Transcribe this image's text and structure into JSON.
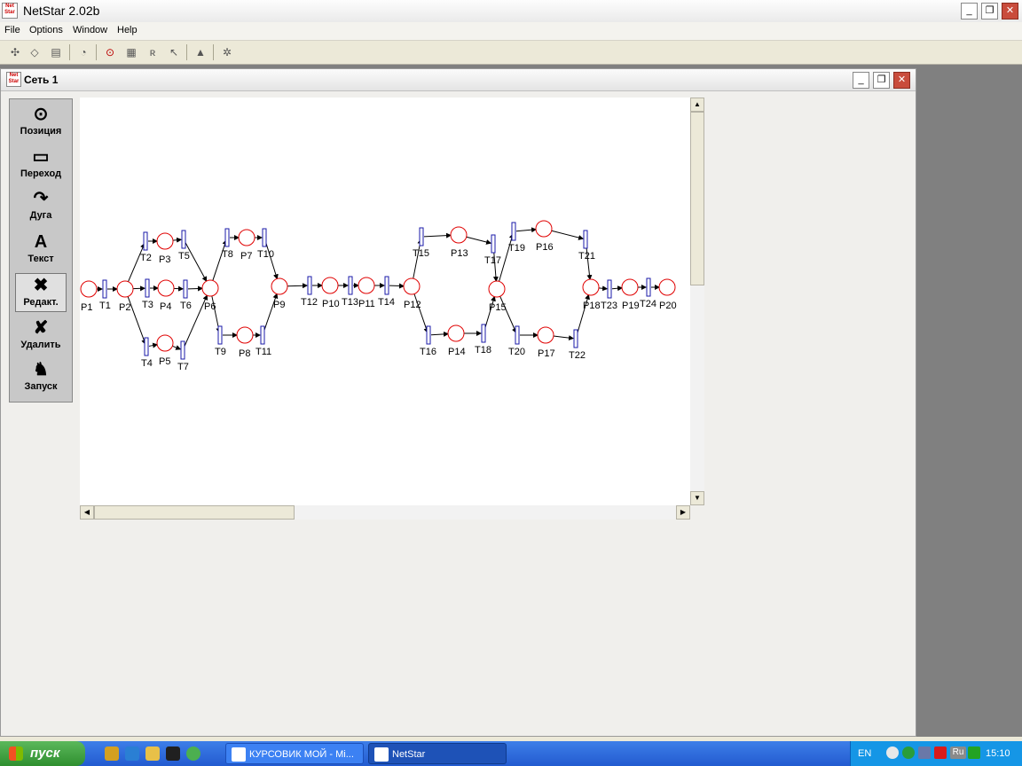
{
  "app": {
    "title": "NetStar 2.02b",
    "logo_text": "Net Star",
    "window_controls": {
      "minimize": "_",
      "restore": "❐",
      "close": "✕"
    }
  },
  "menu": {
    "items": [
      "File",
      "Options",
      "Window",
      "Help"
    ]
  },
  "toolbar": {
    "icons": [
      "network-icon",
      "eraser-icon",
      "copy-icon",
      "clock-icon",
      "petri-net-icon",
      "table-icon",
      "register-icon",
      "cursor-icon",
      "graduate-icon",
      "settings-icon"
    ]
  },
  "child_window": {
    "title": "Сеть 1"
  },
  "palette": {
    "tools": [
      {
        "label": "Позиция",
        "icon": "place-circle-icon"
      },
      {
        "label": "Переход",
        "icon": "transition-bar-icon"
      },
      {
        "label": "Дуга",
        "icon": "arc-arrow-icon"
      },
      {
        "label": "Текст",
        "icon": "text-a-icon"
      },
      {
        "label": "Редакт.",
        "icon": "edit-tools-icon",
        "active": true
      },
      {
        "label": "Удалить",
        "icon": "delete-x-icon"
      },
      {
        "label": "Запуск",
        "icon": "run-person-icon"
      }
    ]
  },
  "net": {
    "places": [
      {
        "id": "P1",
        "label": "P1"
      },
      {
        "id": "P2",
        "label": "P2"
      },
      {
        "id": "P3",
        "label": "P3"
      },
      {
        "id": "P4",
        "label": "P4"
      },
      {
        "id": "P5",
        "label": "P5"
      },
      {
        "id": "P6",
        "label": "P6"
      },
      {
        "id": "P7",
        "label": "P7"
      },
      {
        "id": "P8",
        "label": "P8"
      },
      {
        "id": "P9",
        "label": "P9"
      },
      {
        "id": "P10",
        "label": "P10"
      },
      {
        "id": "P11",
        "label": "P11"
      },
      {
        "id": "P12",
        "label": "P12"
      },
      {
        "id": "P13",
        "label": "P13"
      },
      {
        "id": "P14",
        "label": "P14"
      },
      {
        "id": "P15",
        "label": "P15"
      },
      {
        "id": "P16",
        "label": "P16"
      },
      {
        "id": "P17",
        "label": "P17"
      },
      {
        "id": "P18",
        "label": "P18"
      },
      {
        "id": "P19",
        "label": "P19"
      },
      {
        "id": "P20",
        "label": "P20"
      }
    ],
    "transitions": [
      {
        "id": "T1",
        "label": "T1"
      },
      {
        "id": "T2",
        "label": "T2"
      },
      {
        "id": "T3",
        "label": "T3"
      },
      {
        "id": "T4",
        "label": "T4"
      },
      {
        "id": "T5",
        "label": "T5"
      },
      {
        "id": "T6",
        "label": "T6"
      },
      {
        "id": "T7",
        "label": "T7"
      },
      {
        "id": "T8",
        "label": "T8"
      },
      {
        "id": "T9",
        "label": "T9"
      },
      {
        "id": "T10",
        "label": "T10"
      },
      {
        "id": "T11",
        "label": "T11"
      },
      {
        "id": "T12",
        "label": "T12"
      },
      {
        "id": "T13",
        "label": "T13"
      },
      {
        "id": "T14",
        "label": "T14"
      },
      {
        "id": "T15",
        "label": "T15"
      },
      {
        "id": "T16",
        "label": "T16"
      },
      {
        "id": "T17",
        "label": "T17"
      },
      {
        "id": "T18",
        "label": "T18"
      },
      {
        "id": "T19",
        "label": "T19"
      },
      {
        "id": "T20",
        "label": "T20"
      },
      {
        "id": "T21",
        "label": "T21"
      },
      {
        "id": "T22",
        "label": "T22"
      },
      {
        "id": "T23",
        "label": "T23"
      },
      {
        "id": "T24",
        "label": "T24"
      }
    ],
    "arcs": [
      [
        "P1",
        "T1"
      ],
      [
        "T1",
        "P2"
      ],
      [
        "P2",
        "T2"
      ],
      [
        "P2",
        "T3"
      ],
      [
        "P2",
        "T4"
      ],
      [
        "T2",
        "P3"
      ],
      [
        "T3",
        "P4"
      ],
      [
        "T4",
        "P5"
      ],
      [
        "P3",
        "T5"
      ],
      [
        "P4",
        "T6"
      ],
      [
        "P5",
        "T7"
      ],
      [
        "T5",
        "P6"
      ],
      [
        "T6",
        "P6"
      ],
      [
        "T7",
        "P6"
      ],
      [
        "P6",
        "T8"
      ],
      [
        "P6",
        "T9"
      ],
      [
        "T8",
        "P7"
      ],
      [
        "T9",
        "P8"
      ],
      [
        "P7",
        "T10"
      ],
      [
        "P8",
        "T11"
      ],
      [
        "T10",
        "P9"
      ],
      [
        "T11",
        "P9"
      ],
      [
        "P9",
        "T12"
      ],
      [
        "T12",
        "P10"
      ],
      [
        "P10",
        "T13"
      ],
      [
        "T13",
        "P11"
      ],
      [
        "P11",
        "T14"
      ],
      [
        "T14",
        "P12"
      ],
      [
        "P12",
        "T15"
      ],
      [
        "P12",
        "T16"
      ],
      [
        "T15",
        "P13"
      ],
      [
        "T16",
        "P14"
      ],
      [
        "P13",
        "T17"
      ],
      [
        "P14",
        "T18"
      ],
      [
        "T17",
        "P15"
      ],
      [
        "T18",
        "P15"
      ],
      [
        "P15",
        "T19"
      ],
      [
        "P15",
        "T20"
      ],
      [
        "T19",
        "P16"
      ],
      [
        "T20",
        "P17"
      ],
      [
        "P16",
        "T21"
      ],
      [
        "P17",
        "T22"
      ],
      [
        "T21",
        "P18"
      ],
      [
        "T22",
        "P18"
      ],
      [
        "P18",
        "T23"
      ],
      [
        "T23",
        "P19"
      ],
      [
        "P19",
        "T24"
      ],
      [
        "T24",
        "P20"
      ]
    ],
    "colors": {
      "place": "#e00000",
      "transition": "#1a1aa8",
      "arc": "#000000"
    }
  },
  "taskbar": {
    "start_label": "пуск",
    "quick_launch": [
      "winamp-icon",
      "ie-icon",
      "folder-icon",
      "terminal-icon",
      "torrent-icon"
    ],
    "tasks": [
      {
        "label": "КУРСОВИК МОЙ - Mi...",
        "icon": "word-icon",
        "active": false
      },
      {
        "label": "NetStar",
        "icon": "netstar-icon",
        "active": true
      }
    ],
    "tray": {
      "language": "EN",
      "keyboard": "Ru",
      "time": "15:10",
      "icons": [
        "collapse-icon",
        "antivirus-icon",
        "network-icon",
        "kaspersky-icon",
        "ru-layout-icon",
        "transfer-icon"
      ]
    }
  }
}
